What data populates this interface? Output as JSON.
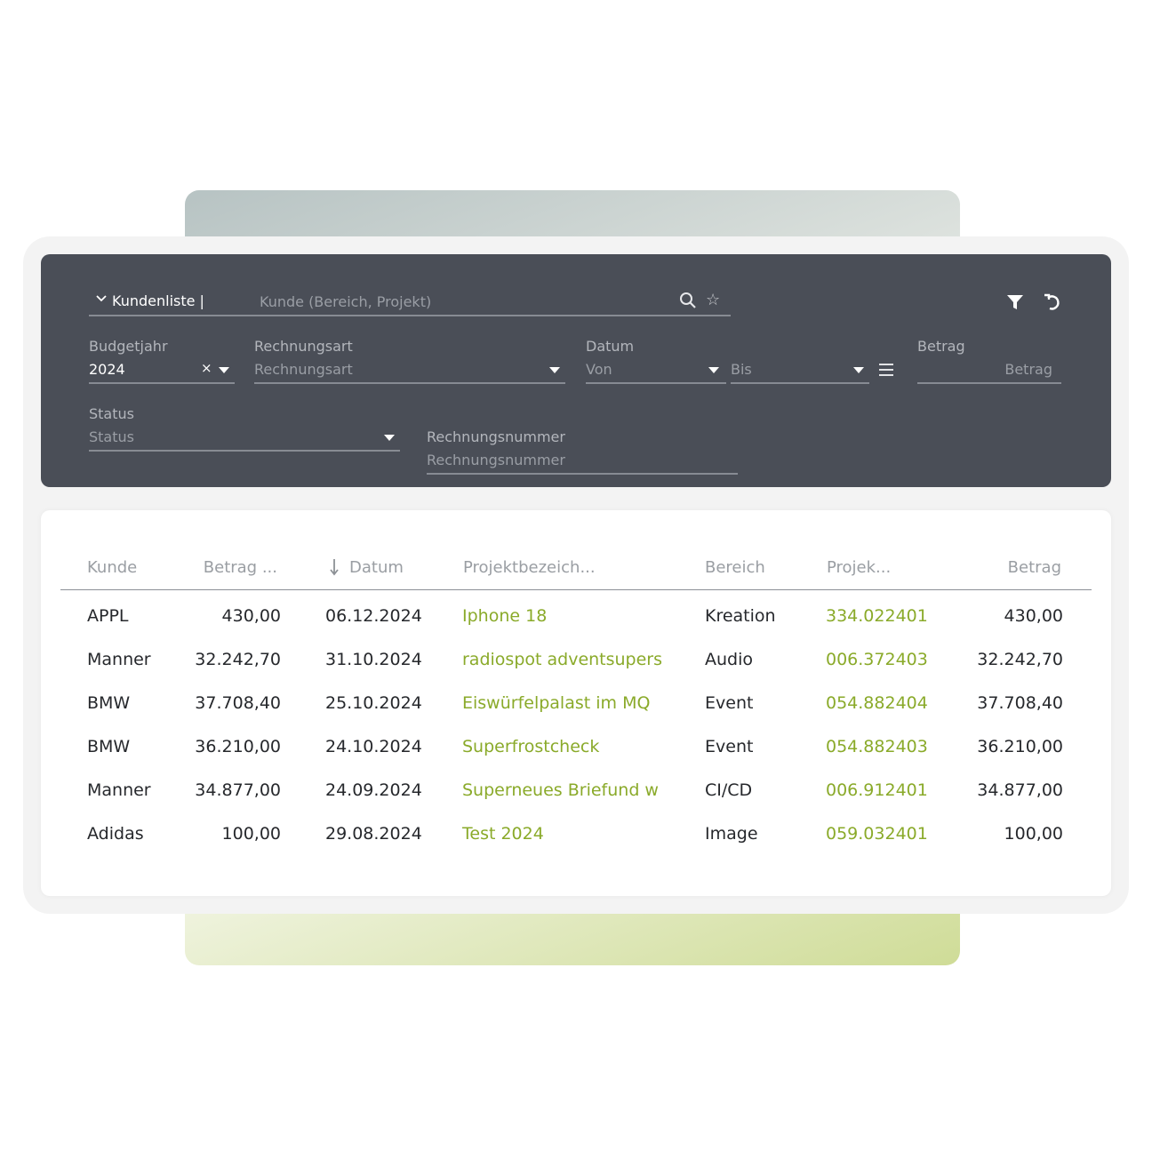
{
  "filters": {
    "list_name": "Kundenliste |",
    "search_placeholder": "Kunde (Bereich, Projekt)",
    "budgetjahr_label": "Budgetjahr",
    "budgetjahr_value": "2024",
    "clear_symbol": "×",
    "rechnungsart_label": "Rechnungsart",
    "rechnungsart_placeholder": "Rechnungsart",
    "datum_label": "Datum",
    "datum_from_placeholder": "Von",
    "datum_to_placeholder": "Bis",
    "betrag_label": "Betrag",
    "betrag_placeholder": "Betrag",
    "status_label": "Status",
    "status_placeholder": "Status",
    "rechnungsnummer_label": "Rechnungsnummer",
    "rechnungsnummer_placeholder": "Rechnungsnummer"
  },
  "table": {
    "headers": [
      "Kunde",
      "Betrag ...",
      "Datum",
      "Projektbezeich...",
      "Bereich",
      "Projek...",
      "Betrag"
    ],
    "rows": [
      [
        "APPL",
        "430,00",
        "06.12.2024",
        "Iphone 18",
        "Kreation",
        "334.022401",
        "430,00"
      ],
      [
        "Manner",
        "32.242,70",
        "31.10.2024",
        "radiospot adventsupers",
        "Audio",
        "006.372403",
        "32.242,70"
      ],
      [
        "BMW",
        "37.708,40",
        "25.10.2024",
        "Eiswürfelpalast im MQ",
        "Event",
        "054.882404",
        "37.708,40"
      ],
      [
        "BMW",
        "36.210,00",
        "24.10.2024",
        "Superfrostcheck",
        "Event",
        "054.882403",
        "36.210,00"
      ],
      [
        "Manner",
        "34.877,00",
        "24.09.2024",
        "Superneues Briefund w",
        "CI/CD",
        "006.912401",
        "34.877,00"
      ],
      [
        "Adidas",
        "100,00",
        "29.08.2024",
        "Test 2024",
        "Image",
        "059.032401",
        "100,00"
      ]
    ]
  },
  "colors": {
    "panel": "#4a4e57",
    "link_green": "#8aaa2a",
    "text_dark": "#26282c",
    "header_gray": "#9a9ea3"
  },
  "icons": [
    "chevron-down-icon",
    "search-icon",
    "star-icon",
    "filter-icon",
    "reset-icon",
    "caret-down-icon",
    "list-icon",
    "sort-down-icon"
  ]
}
